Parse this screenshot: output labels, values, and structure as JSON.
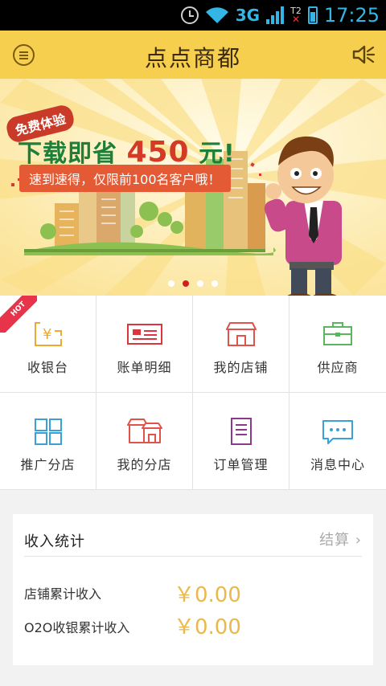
{
  "status_bar": {
    "network": "3G",
    "time": "17:25",
    "sim2": "T2"
  },
  "header": {
    "title": "点点商都"
  },
  "banner": {
    "badge": "免费体验",
    "headline_prefix": "下载即省",
    "headline_number": "450",
    "headline_suffix": "元!",
    "subline": "速到速得，仅限前100名客户哦！",
    "slide_count": 4,
    "active_slide": 2
  },
  "grid": {
    "hot_badge": "HOT",
    "items": [
      {
        "label": "收银台",
        "icon": "cashier-icon",
        "color": "#f0a830"
      },
      {
        "label": "账单明细",
        "icon": "bill-icon",
        "color": "#d9363e"
      },
      {
        "label": "我的店铺",
        "icon": "shop-icon",
        "color": "#e0534a"
      },
      {
        "label": "供应商",
        "icon": "briefcase-icon",
        "color": "#5bb55e"
      },
      {
        "label": "推广分店",
        "icon": "grid-icon",
        "color": "#3aa0d8"
      },
      {
        "label": "我的分店",
        "icon": "branch-shop-icon",
        "color": "#e0534a"
      },
      {
        "label": "订单管理",
        "icon": "document-icon",
        "color": "#8b3a8b"
      },
      {
        "label": "消息中心",
        "icon": "message-icon",
        "color": "#3aa0d8"
      }
    ]
  },
  "income": {
    "title": "收入统计",
    "settle_label": "结算",
    "rows": [
      {
        "label": "店铺累计收入",
        "value": "￥0.00"
      },
      {
        "label": "O2O收银累计收入",
        "value": "￥0.00"
      }
    ]
  }
}
